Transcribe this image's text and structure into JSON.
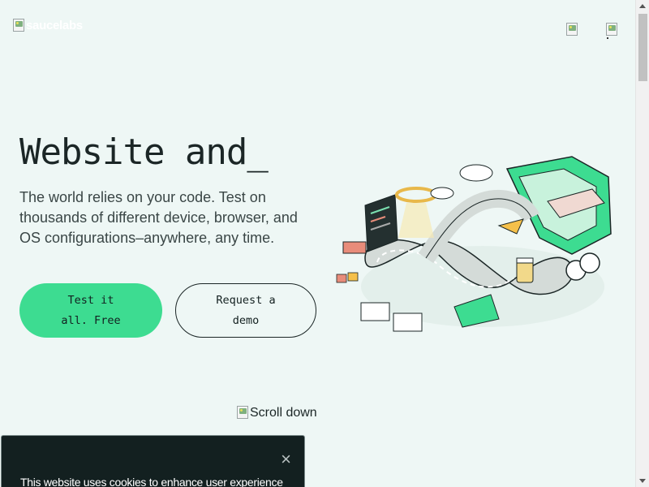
{
  "header": {
    "logo_alt": "saucelabs",
    "icons": [
      "broken-image-icon",
      "broken-image-icon"
    ]
  },
  "hero": {
    "title": "Website and_",
    "description": "The world relies on your code. Test on thousands of different device, browser, and OS configurations–anywhere, any time.",
    "primary_button": "Test it all. Free",
    "secondary_button": "Request a demo"
  },
  "scroll": {
    "alt": "Scroll down"
  },
  "cookie": {
    "text": "This website uses cookies to enhance user experience",
    "close_label": "×"
  },
  "colors": {
    "background": "#eef7f5",
    "accent": "#3ddc91",
    "dark": "#132020"
  }
}
